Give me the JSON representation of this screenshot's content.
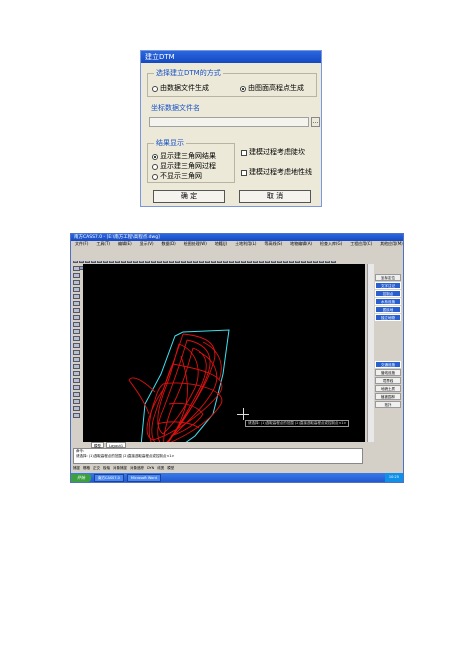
{
  "dialog": {
    "title": "建立DTM",
    "method_group": "选择建立DTM的方式",
    "method_options": [
      "由数据文件生成",
      "由图面高程点生成"
    ],
    "method_selected": 1,
    "file_group": "坐标数据文件名",
    "file_value": "",
    "browse_label": "...",
    "result_group": "结果显示",
    "result_options": [
      "显示建三角网结果",
      "显示建三角网过程",
      "不显示三角网"
    ],
    "result_selected": 0,
    "check_options": [
      "建模过程考虑陡坎",
      "建模过程考虑地性线"
    ],
    "ok_label": "确 定",
    "cancel_label": "取 消"
  },
  "cad": {
    "title": "南方CASS7.0 - [E:\\南方工程\\高程点.dwg]",
    "menus": [
      "文件(F)",
      "工具(T)",
      "编辑(E)",
      "显示(V)",
      "数据(D)",
      "绘图处理(W)",
      "地籍(J)",
      "土地利用(L)",
      "等高线(S)",
      "地物编辑(A)",
      "检查入库(G)",
      "工程应用(C)",
      "其他应用(M)"
    ],
    "right_panel": [
      "坐标定位",
      "文字注记",
      "控制点",
      "水系设施",
      "居民地",
      "独立地物",
      "交通设施",
      "管线设施",
      "境界线",
      "地貌土质",
      "植被园林",
      "拓扑"
    ],
    "tabs": [
      "模型",
      "Layout1"
    ],
    "cmd_lines": [
      "命令:",
      "请选择: (1)选取高程点的范围 (2)直接选取高程点或控制点<1>"
    ],
    "status_items": [
      "捕捉",
      "栅格",
      "正交",
      "极轴",
      "对象捕捉",
      "对象追踪",
      "DYN",
      "线宽",
      "模型"
    ],
    "tooltip": "请选择: (1)选取高程点的范围 (2)直接选取高程点或控制点<1>",
    "taskbar_start": "开始",
    "taskbar_tasks": [
      "南方CASS7.0",
      "Microsoft Word"
    ],
    "clock": "10:25"
  },
  "colors": {
    "accent": "#1550c8",
    "title_bar": "#1548c0",
    "contour": "#e01010",
    "boundary": "#40e0f0"
  }
}
